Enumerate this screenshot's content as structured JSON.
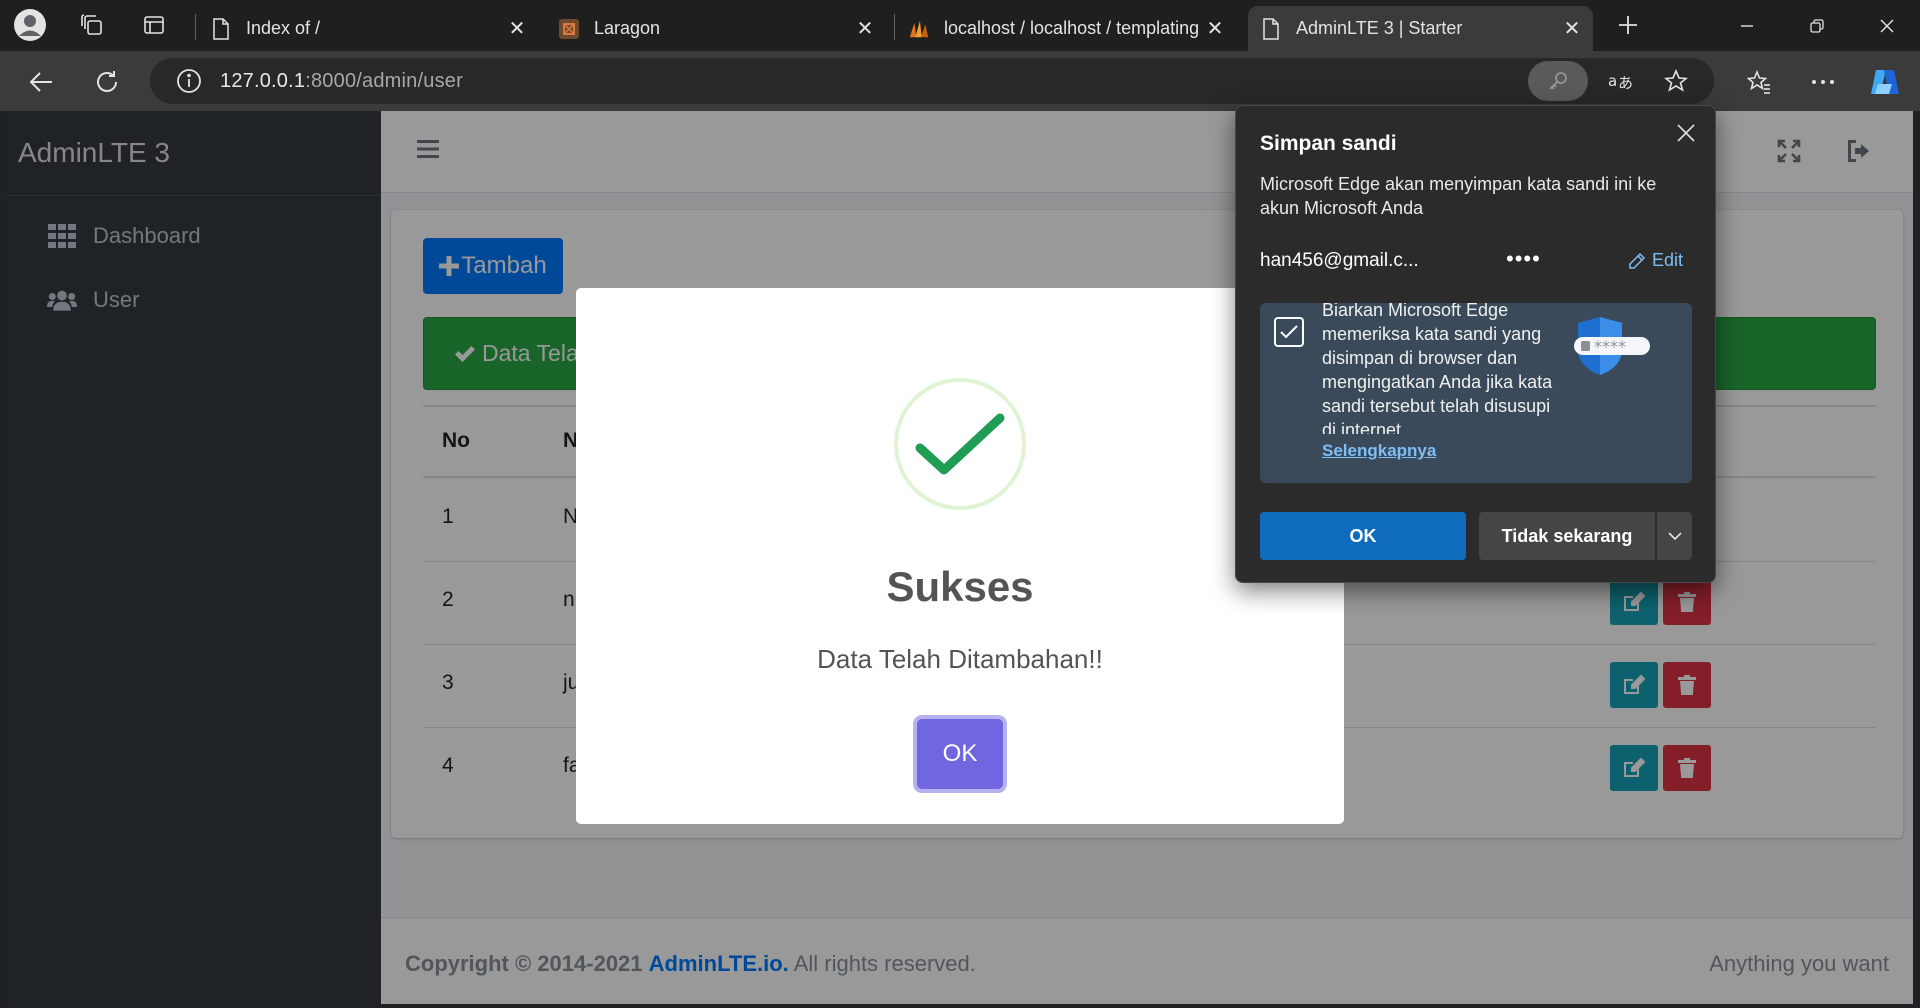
{
  "browser": {
    "tabs": [
      {
        "title": "Index of /"
      },
      {
        "title": "Laragon"
      },
      {
        "title": "localhost / localhost / templating"
      },
      {
        "title": "AdminLTE 3 | Starter"
      }
    ],
    "url_host": "127.0.0.1",
    "url_path": ":8000/admin/user"
  },
  "sidebar": {
    "brand": "AdminLTE 3",
    "items": [
      {
        "label": "Dashboard",
        "icon": "grid-icon"
      },
      {
        "label": "User",
        "icon": "users-icon"
      }
    ]
  },
  "content": {
    "add_button": "Tambah",
    "alert_text": "Data Tela",
    "columns": [
      "No",
      "N"
    ],
    "rows": [
      {
        "no": "1",
        "name": "N"
      },
      {
        "no": "2",
        "name": "n"
      },
      {
        "no": "3",
        "name": "ju"
      },
      {
        "no": "4",
        "name": "fa"
      }
    ]
  },
  "footer": {
    "copyright": "Copyright © 2014-2021",
    "brand_link": "AdminLTE.io.",
    "rights": "All rights reserved.",
    "right_text": "Anything you want"
  },
  "modal": {
    "title": "Sukses",
    "message": "Data Telah Ditambahan!!",
    "ok": "OK"
  },
  "password_popup": {
    "title": "Simpan sandi",
    "description": "Microsoft Edge akan menyimpan kata sandi ini ke akun Microsoft Anda",
    "email": "han456@gmail.c...",
    "password_mask": "••••",
    "edit": "Edit",
    "check_text": "Biarkan Microsoft Edge memeriksa kata sandi yang disimpan di browser dan mengingatkan Anda jika kata sandi tersebut telah disusupi di internet",
    "learn_more": "Selengkapnya",
    "ok": "OK",
    "not_now": "Tidak sekarang"
  },
  "colors": {
    "primary": "#007bff",
    "success": "#28a745",
    "info": "#17a2b8",
    "danger": "#dc3545",
    "swal_button": "#7066e0",
    "edge_blue": "#0f6cbd"
  }
}
